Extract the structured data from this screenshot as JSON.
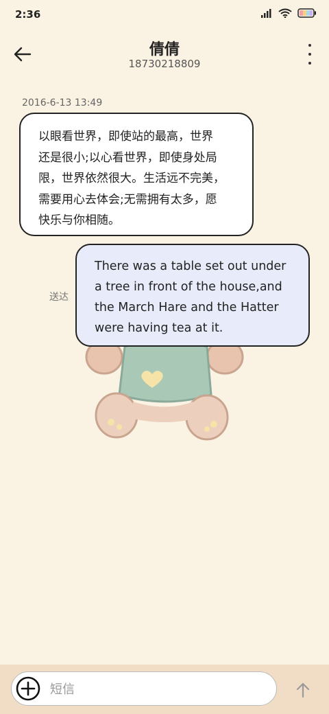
{
  "status_bar": {
    "time": "2:36",
    "icons": [
      "signal-icon",
      "wifi-icon",
      "battery-icon"
    ]
  },
  "header": {
    "contact_name": "倩倩",
    "contact_number": "18730218809",
    "back_icon": "arrow-left-icon",
    "menu_icon": "more-vertical-icon"
  },
  "conversation": {
    "timestamp": "2016-6-13 13:49",
    "incoming_message": {
      "lines": [
        "以眼看世界，即使站的最高，世界",
        "还是很小;以心看世界，即使身处局",
        "限，世界依然很大。生活远不完美，",
        "需要用心去体会;无需拥有太多，愿",
        "快乐与你相随。"
      ]
    },
    "outgoing_message": {
      "lines": [
        "There was a table set out under",
        "a tree in front of the house,and",
        "the March Hare and the Hatter",
        "were having tea at it."
      ],
      "status": "送达"
    }
  },
  "composer": {
    "placeholder": "短信",
    "add_icon": "plus-circle-icon",
    "send_icon": "arrow-up-icon"
  },
  "colors": {
    "background": "#faf2e2",
    "incoming_bubble": "#ffffff",
    "outgoing_bubble": "#e8ecfa",
    "composer_bar": "#f1dcc6"
  }
}
